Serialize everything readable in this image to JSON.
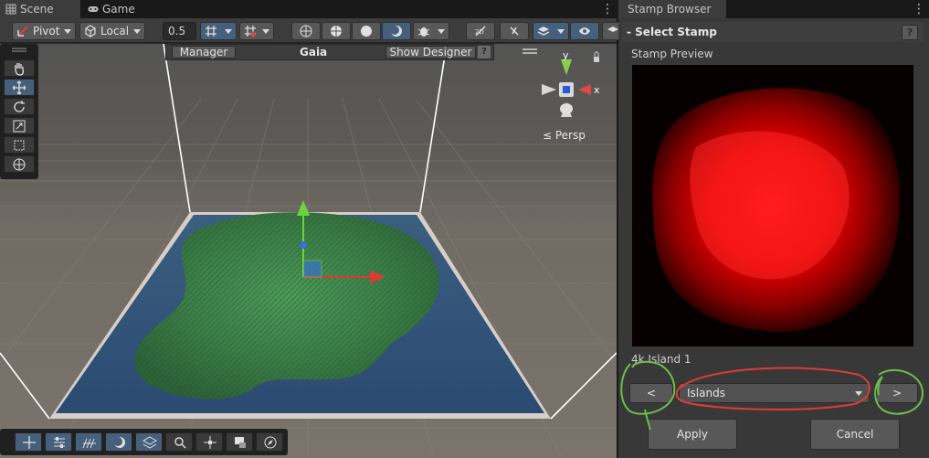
{
  "scene_window": {
    "tabs": [
      {
        "label": "Scene",
        "icon": "grid-icon"
      },
      {
        "label": "Game",
        "icon": "gamepad-icon"
      }
    ],
    "toolbar": {
      "pivot_label": "Pivot",
      "local_label": "Local",
      "grid_snap_value": "0.5"
    },
    "gaia_bar": {
      "manager_label": "Manager",
      "title": "Gaia",
      "show_designer_label": "Show Designer",
      "help_label": "?"
    },
    "gizmo": {
      "y_label": "y",
      "x_label": "x",
      "projection_label": "≤ Persp"
    }
  },
  "stamp_browser": {
    "tab_label": "Stamp Browser",
    "section_title": "- Select Stamp",
    "help_label": "?",
    "preview_label": "Stamp Preview",
    "stamp_name": "4k Island 1",
    "prev_label": "<",
    "next_label": ">",
    "category_selected": "Islands",
    "apply_label": "Apply",
    "cancel_label": "Cancel"
  },
  "colors": {
    "accent_blue": "#46607c",
    "terrain_green": "#3f8a4e",
    "water_blue": "#2f4f7a",
    "annotation_green": "#6cc04a",
    "annotation_red": "#e03a3a",
    "stamp_red": "#ff0000"
  }
}
